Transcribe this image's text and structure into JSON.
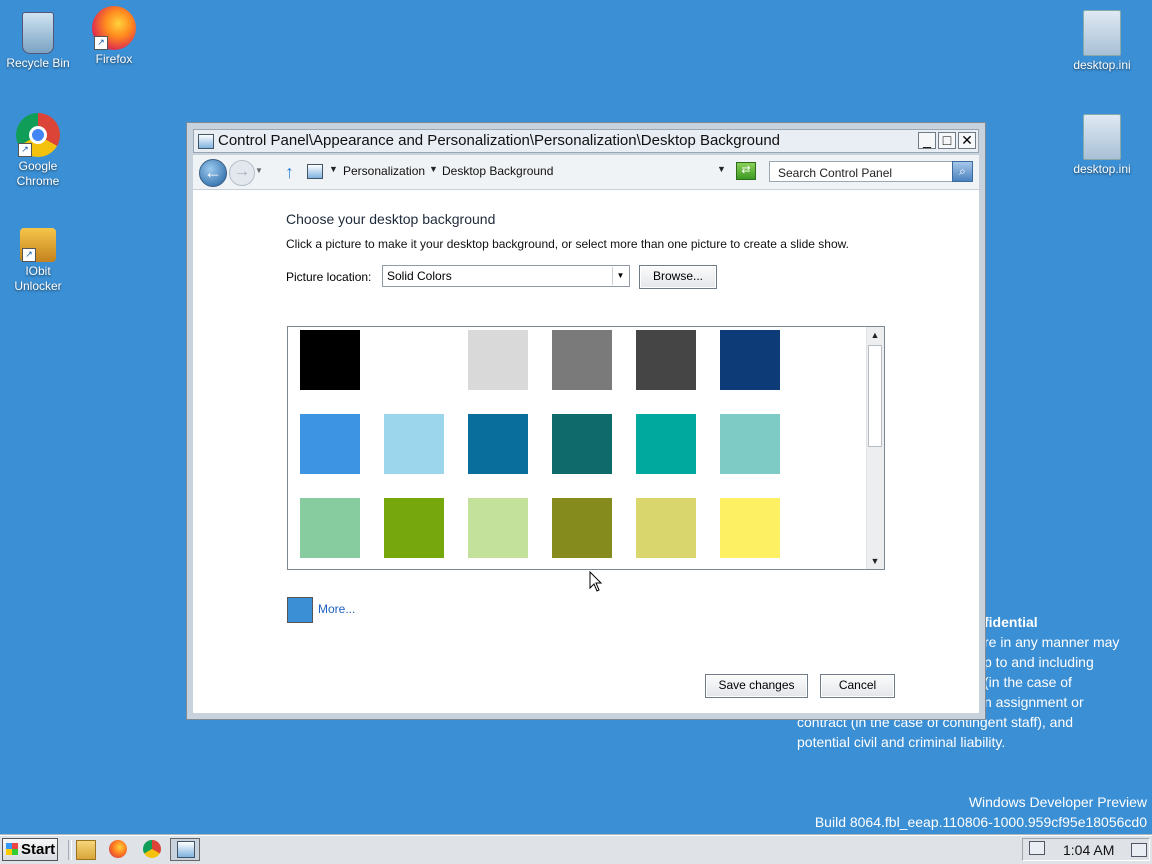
{
  "desktop": {
    "icons_left": [
      {
        "label": "Recycle Bin",
        "icon": "recycle-bin-icon"
      },
      {
        "label": "Firefox",
        "icon": "firefox-icon"
      },
      {
        "label": "Google Chrome",
        "icon": "chrome-icon"
      },
      {
        "label": "IObit Unlocker",
        "icon": "unlocker-icon"
      }
    ],
    "icons_right": [
      {
        "label": "desktop.ini",
        "icon": "ini-file-icon"
      },
      {
        "label": "desktop.ini",
        "icon": "ini-file-icon"
      }
    ],
    "watermark": {
      "partial_lines": [
        "fidential",
        "re in any manner may",
        "p to and including",
        "(in the case of",
        "n assignment or",
        "contract (in the case of contingent staff), and",
        "potential civil and criminal liability."
      ],
      "product": "Windows Developer Preview",
      "build": "Build 8064.fbl_eeap.110806-1000.959cf95e18056cd0"
    }
  },
  "window": {
    "title": "Control Panel\\Appearance and Personalization\\Personalization\\Desktop Background",
    "controls": {
      "minimize": "_",
      "maximize": "□",
      "close": "✕"
    },
    "breadcrumb": [
      "Personalization",
      "Desktop Background"
    ],
    "search_placeholder": "Search Control Panel",
    "heading": "Choose your desktop background",
    "description": "Click a picture to make it your desktop background, or select more than one picture to create a slide show.",
    "picture_location_label": "Picture location:",
    "picture_location_value": "Solid Colors",
    "browse_label": "Browse...",
    "swatches": [
      "#000000",
      "#ffffff",
      "#d9d9d9",
      "#7a7a7a",
      "#454545",
      "#0c3b78",
      "#3d94e3",
      "#9bd6ec",
      "#0a6e9c",
      "#0f6a6c",
      "#00a99d",
      "#7ecac4",
      "#87cc9e",
      "#76a70c",
      "#c4e19b",
      "#868b1e",
      "#d9d66e",
      "#fdf163"
    ],
    "more_label": "More...",
    "more_color": "#3b8fd4",
    "save_label": "Save changes",
    "cancel_label": "Cancel"
  },
  "taskbar": {
    "start_label": "Start",
    "clock": "1:04 AM"
  }
}
